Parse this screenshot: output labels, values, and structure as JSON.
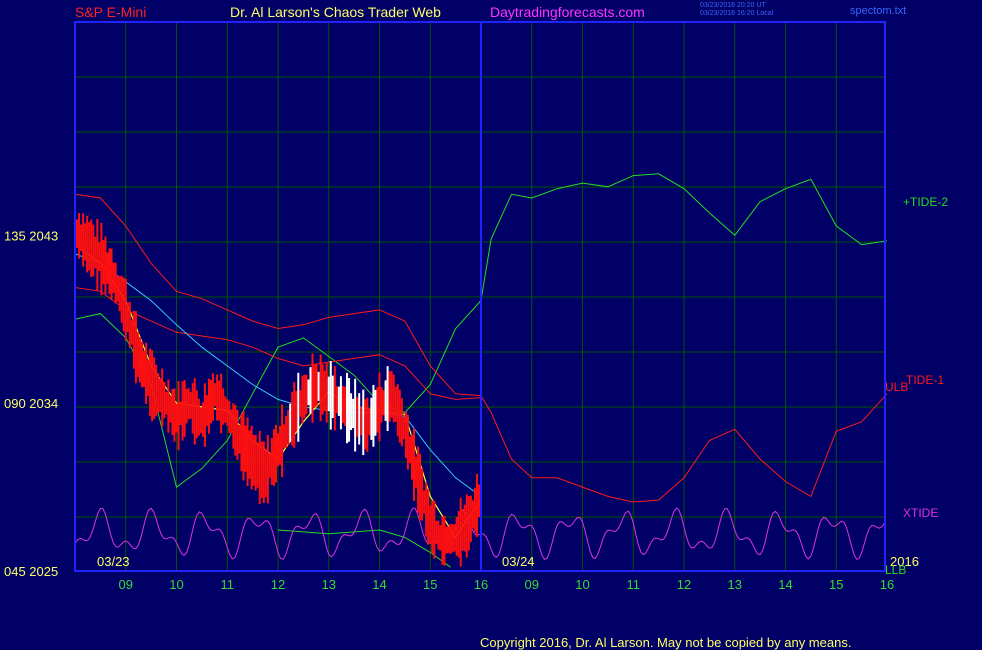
{
  "header": {
    "symbol": "S&P E-Mini",
    "author": "Dr. Al Larson's Chaos Trader Web",
    "site": "Daytradingforecasts.com",
    "stamp_utc": "03/23/2016 20:20 UT",
    "stamp_local": "03/23/2016 16:20 Local",
    "source_file": "spectom.txt"
  },
  "footer": {
    "copyright": "Copyright 2016, Dr. Al Larson. May not be copied by any means."
  },
  "colors": {
    "background": "#000066",
    "frame": "#2222ff",
    "grid": "#005500",
    "tide1": "#ff1a1a",
    "tide2": "#22dd22",
    "xtide": "#dd33dd",
    "ma_fast": "#ffff33",
    "ma_slow": "#33ccff",
    "bar_up": "#ffffff",
    "bar_down": "#ff1010"
  },
  "chart_data": {
    "type": "line",
    "title": "S&P E-Mini",
    "x_unit": "hour",
    "x": [
      8,
      8.5,
      9,
      9.5,
      10,
      10.5,
      11,
      11.5,
      12,
      12.5,
      13,
      13.5,
      14,
      14.5,
      15,
      15.5,
      16
    ],
    "ylim": [
      2025,
      2045
    ],
    "y_ticks_left": [
      {
        "value": 2043,
        "label": "135  2043"
      },
      {
        "value": 2034,
        "label": "090  2034"
      },
      {
        "value": 2025,
        "label": "045  2025"
      }
    ],
    "x_ticks": [
      {
        "hour": 9,
        "label": "09"
      },
      {
        "hour": 10,
        "label": "10"
      },
      {
        "hour": 11,
        "label": "11"
      },
      {
        "hour": 12,
        "label": "12"
      },
      {
        "hour": 13,
        "label": "13"
      },
      {
        "hour": 14,
        "label": "14"
      },
      {
        "hour": 15,
        "label": "15"
      },
      {
        "hour": 16,
        "label": "16"
      },
      {
        "hour": 17,
        "label": "09"
      },
      {
        "hour": 18,
        "label": "10"
      },
      {
        "hour": 19,
        "label": "11"
      },
      {
        "hour": 20,
        "label": "12"
      },
      {
        "hour": 21,
        "label": "13"
      },
      {
        "hour": 22,
        "label": "14"
      },
      {
        "hour": 23,
        "label": "15"
      },
      {
        "hour": 24,
        "label": "16"
      }
    ],
    "day_labels": [
      "03/23",
      "03/24"
    ],
    "year_label": "2016",
    "series": [
      {
        "name": "+TIDE-2",
        "x": [
          8,
          8.5,
          9,
          9.5,
          10,
          10.5,
          11,
          11.5,
          12,
          12.5,
          13,
          13.5,
          14,
          14.5,
          15,
          15.5,
          16,
          16.2,
          16.6,
          17,
          17.5,
          18,
          18.5,
          19,
          19.5,
          20,
          20.5,
          21,
          21.5,
          22,
          22.5,
          23,
          23.5,
          24
        ],
        "values": [
          2038.5,
          2038.8,
          2037.5,
          2035.0,
          2029.5,
          2030.5,
          2032.0,
          2034.5,
          2037.0,
          2037.5,
          2036.5,
          2035.5,
          2034.0,
          2033.5,
          2035.0,
          2038.0,
          2039.5,
          2042.8,
          2045.2,
          2045.0,
          2045.5,
          2045.8,
          2045.6,
          2046.2,
          2046.3,
          2045.5,
          2044.2,
          2043.0,
          2044.8,
          2045.5,
          2046.0,
          2043.5,
          2042.5,
          2042.7
        ]
      },
      {
        "name": "TIDE-1",
        "x": [
          8,
          8.5,
          9,
          9.5,
          10,
          10.5,
          11,
          11.5,
          12,
          12.5,
          13,
          13.5,
          14,
          14.5,
          15,
          15.5,
          16,
          16.2,
          16.6,
          17,
          17.5,
          18,
          18.5,
          19,
          19.5,
          20,
          20.5,
          21,
          21.5,
          22,
          22.5,
          23,
          23.5,
          24
        ],
        "values": [
          2045.2,
          2045.0,
          2043.5,
          2041.5,
          2040.0,
          2039.6,
          2039.0,
          2038.4,
          2038.0,
          2038.2,
          2038.6,
          2038.8,
          2039.0,
          2038.4,
          2036.0,
          2034.5,
          2034.4,
          2033.5,
          2031.0,
          2030.0,
          2030.0,
          2029.5,
          2029.0,
          2028.7,
          2028.8,
          2030.0,
          2032.0,
          2032.6,
          2031.0,
          2029.8,
          2029.0,
          2032.5,
          2033.0,
          2034.5
        ]
      },
      {
        "name": "XTIDE",
        "x": [
          8,
          16,
          24
        ],
        "values": [
          2027.0,
          2027.0,
          2027.0
        ]
      },
      {
        "name": "LLB",
        "x": [
          12,
          13,
          14,
          14.5,
          15,
          15.4
        ],
        "values": [
          2027.2,
          2027.0,
          2027.2,
          2026.8,
          2026.0,
          2025.2
        ]
      },
      {
        "name": "ULB",
        "x": [
          8,
          8.5,
          9,
          9.5,
          10,
          10.5,
          11,
          11.5,
          12,
          12.5,
          13,
          13.5,
          14,
          14.5,
          15,
          15.5,
          16
        ],
        "values": [
          2040.2,
          2040.0,
          2039.0,
          2038.4,
          2037.8,
          2037.6,
          2037.4,
          2037.0,
          2036.4,
          2036.0,
          2036.2,
          2036.4,
          2036.6,
          2036.0,
          2034.5,
          2034.2,
          2034.3
        ]
      },
      {
        "name": "price",
        "x": [
          8,
          8.25,
          8.5,
          8.75,
          9,
          9.25,
          9.5,
          9.75,
          10,
          10.25,
          10.5,
          10.75,
          11,
          11.25,
          11.5,
          11.75,
          12,
          12.25,
          12.5,
          12.75,
          13,
          13.25,
          13.5,
          13.75,
          14,
          14.25,
          14.5,
          14.75,
          15,
          15.25,
          15.5,
          15.75,
          16
        ],
        "values": [
          2043.2,
          2042.5,
          2041.8,
          2040.8,
          2039.0,
          2036.5,
          2035.0,
          2034.2,
          2033.2,
          2034.0,
          2033.0,
          2034.5,
          2033.5,
          2032.0,
          2031.0,
          2030.2,
          2031.5,
          2033.0,
          2034.3,
          2035.0,
          2034.5,
          2034.0,
          2033.4,
          2032.8,
          2033.8,
          2034.5,
          2032.5,
          2030.0,
          2027.5,
          2026.6,
          2026.8,
          2027.5,
          2029.0
        ]
      },
      {
        "name": "ma_fast",
        "x": [
          8,
          8.5,
          9,
          9.5,
          10,
          10.5,
          11,
          11.5,
          12,
          12.5,
          13,
          13.5,
          14,
          14.5,
          15,
          15.5,
          16
        ],
        "values": [
          2042.5,
          2041.5,
          2039.5,
          2036.0,
          2034.0,
          2033.8,
          2033.6,
          2032.0,
          2031.0,
          2033.0,
          2034.6,
          2033.8,
          2033.6,
          2033.4,
          2029.0,
          2026.8,
          2028.8
        ]
      },
      {
        "name": "ma_slow",
        "x": [
          8,
          8.5,
          9,
          9.5,
          10,
          10.5,
          11,
          11.5,
          12,
          12.5,
          13,
          13.5,
          14,
          14.5,
          15,
          15.5,
          16
        ],
        "values": [
          2042.0,
          2041.5,
          2040.5,
          2039.5,
          2038.2,
          2037.0,
          2036.0,
          2035.0,
          2034.2,
          2033.8,
          2033.6,
          2033.5,
          2033.5,
          2033.3,
          2031.5,
          2030.0,
          2029.0
        ]
      }
    ],
    "series_labels": [
      {
        "text": "+TIDE-2"
      },
      {
        "text": "TIDE-1"
      },
      {
        "text": "ULB"
      },
      {
        "text": "XTIDE"
      },
      {
        "text": "LLB"
      }
    ],
    "grid": true,
    "legend": "none"
  }
}
